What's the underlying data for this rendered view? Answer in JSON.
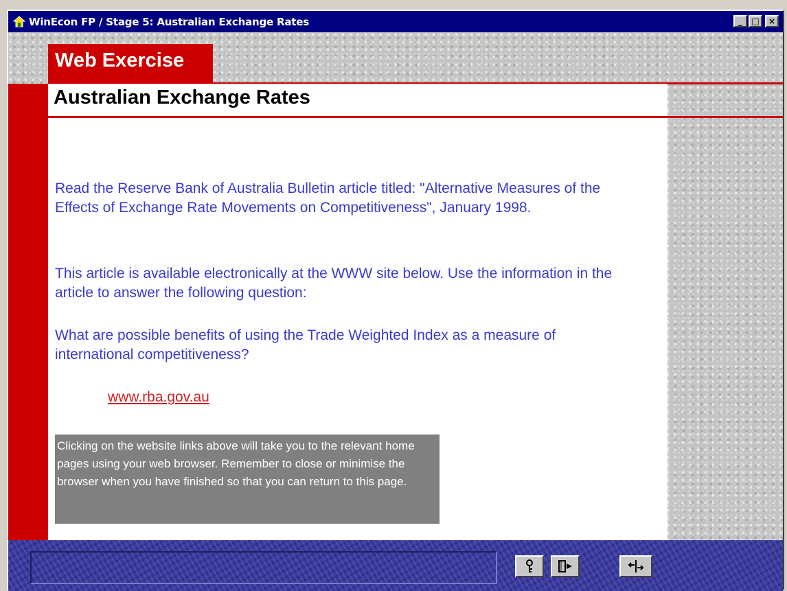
{
  "window": {
    "title": "WinEcon FP / Stage 5: Australian Exchange Rates",
    "controls": {
      "minimize": "_",
      "maximize": "□",
      "close": "×"
    }
  },
  "header": {
    "section_tab": "Web Exercise",
    "page_title": "Australian Exchange Rates"
  },
  "content": {
    "paragraphs": [
      "Read the Reserve Bank of Australia Bulletin article titled: \"Alternative Measures of the Effects of Exchange Rate Movements on Competitiveness\", January 1998.",
      "This article is available electronically at the WWW site below. Use the information in the article to answer the following question:",
      "What are possible benefits of using the Trade Weighted Index as a measure of international competitiveness?"
    ],
    "link": "www.rba.gov.au",
    "note": "Clicking on the website links above will take you to the relevant home pages using your web browser. Remember to close or minimise the browser when you have finished so that you can return to this page."
  },
  "toolbar": {
    "buttons": [
      {
        "icon": "key-icon"
      },
      {
        "icon": "book-icon"
      },
      {
        "icon": "exit-icon"
      }
    ]
  },
  "colors": {
    "accent_red": "#cc0000",
    "text_blue": "#3a3acc",
    "link_red": "#cc2222",
    "titlebar_navy": "#000080",
    "toolbar_blue": "#3a3aa0"
  }
}
